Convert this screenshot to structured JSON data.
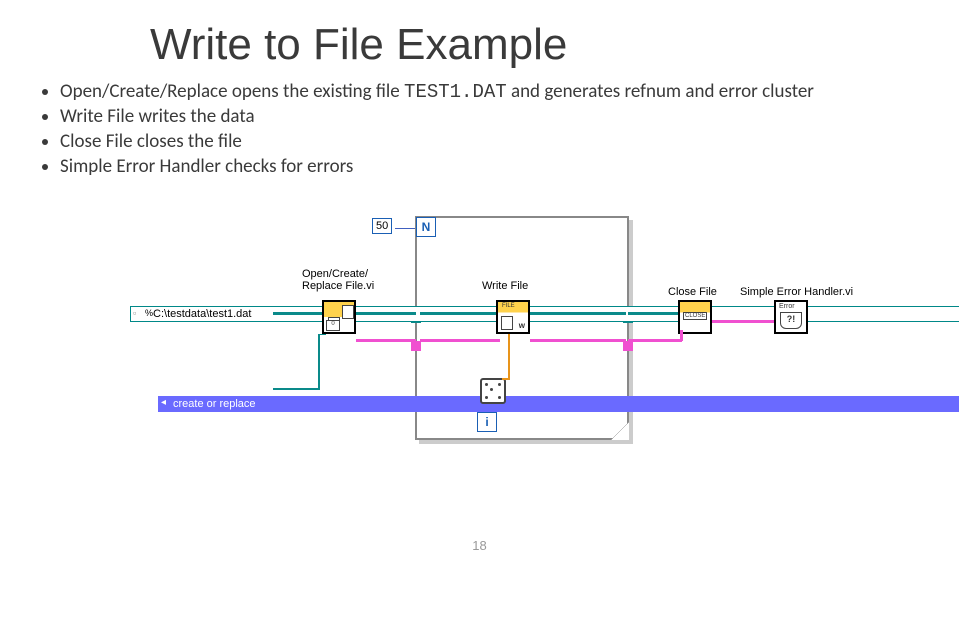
{
  "title": "Write to File Example",
  "bullets": [
    {
      "pre": "Open/Create/Replace opens the existing file ",
      "code": "TEST1.DAT",
      "post": "   and generates refnum and error cluster"
    },
    {
      "pre": "Write File writes the data",
      "code": "",
      "post": ""
    },
    {
      "pre": "Close File closes the file",
      "code": "",
      "post": ""
    },
    {
      "pre": "Simple Error Handler checks for errors",
      "code": "",
      "post": ""
    }
  ],
  "diagram": {
    "const50": "50",
    "N": "N",
    "i": "i",
    "path": "C:\\testdata\\test1.dat",
    "selector": "create or replace",
    "labels": {
      "open": "Open/Create/\nReplace File.vi",
      "write": "Write File",
      "close": "Close File",
      "error": "Simple Error Handler.vi"
    }
  },
  "page": "18"
}
